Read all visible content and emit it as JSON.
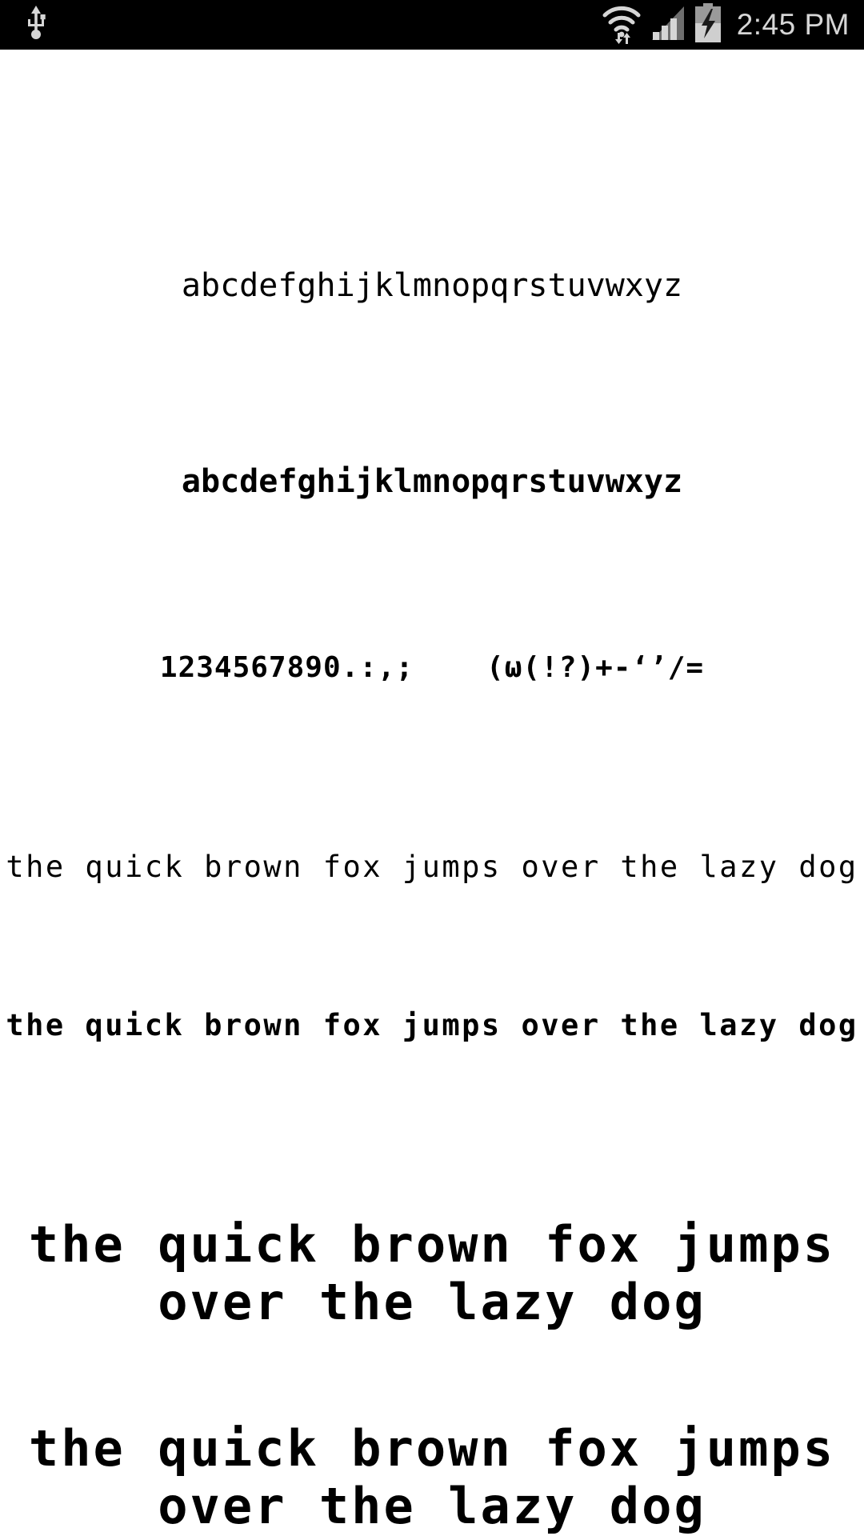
{
  "status_bar": {
    "background_color": "#000000",
    "icon_color": "#d6d6d6",
    "time": "2:45 PM",
    "icons": {
      "usb": "usb-icon",
      "wifi": "wifi-icon",
      "signal": "cellular-signal-icon",
      "battery": "battery-charging-icon"
    }
  },
  "page": {
    "background_color": "#ffffff",
    "text_color": "#000000"
  },
  "samples": [
    {
      "name": "alphabet-regular",
      "text": "abcdefghijklmnopqrstuvwxyz"
    },
    {
      "name": "alphabet-bold",
      "text": "abcdefghijklmnopqrstuvwxyz"
    },
    {
      "name": "numerals-and-symbols",
      "text": "1234567890.:,;    (ω(!?)+-‘’/="
    },
    {
      "name": "pangram-small-regular",
      "text": "the quick brown fox jumps over the lazy dog"
    },
    {
      "name": "pangram-small-bold",
      "text": "the quick brown fox jumps over the lazy dog"
    },
    {
      "name": "pangram-large-regular",
      "text": "the quick brown fox jumps over the lazy dog"
    },
    {
      "name": "pangram-large-bold",
      "text": "the quick brown fox jumps over the lazy dog"
    }
  ]
}
